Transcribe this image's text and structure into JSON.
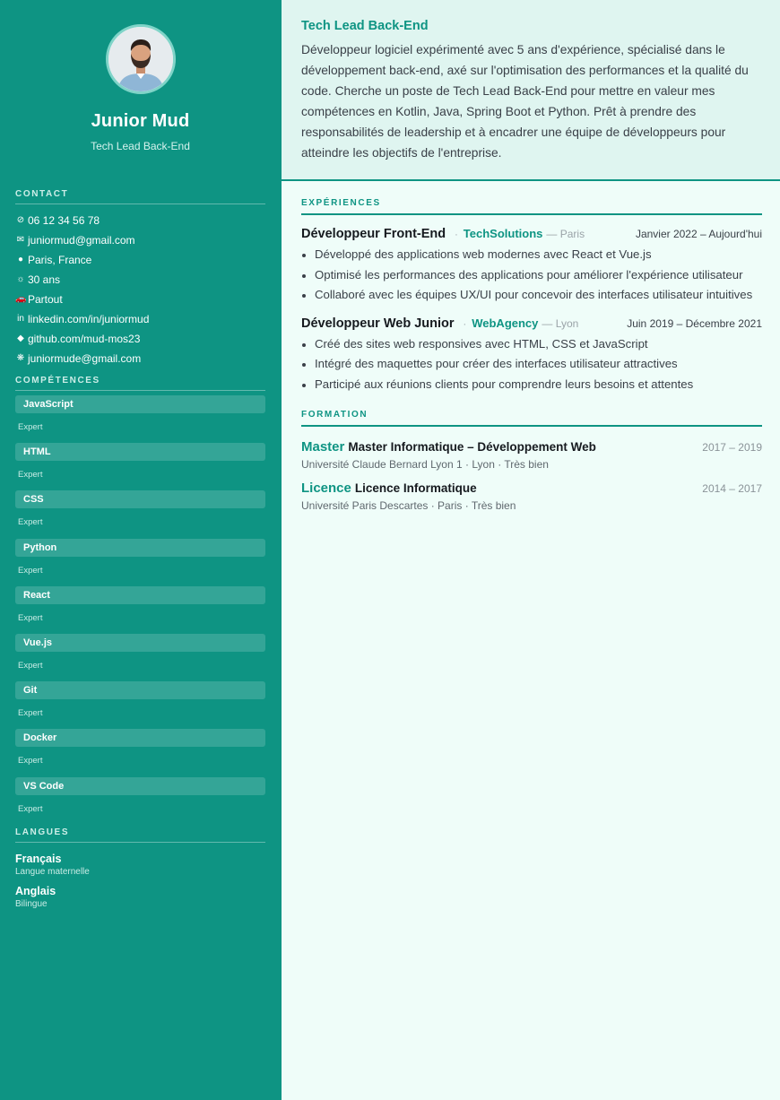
{
  "profile": {
    "name": "Junior Mud",
    "title": "Tech Lead Back-End"
  },
  "contact": {
    "section_title": "CONTACT",
    "items": [
      {
        "icon": "phone-icon",
        "glyph": "⊘",
        "text": "06 12 34 56 78"
      },
      {
        "icon": "email-icon",
        "glyph": "✉",
        "text": "juniormud@gmail.com"
      },
      {
        "icon": "location-icon",
        "glyph": "●",
        "text": "Paris, France"
      },
      {
        "icon": "age-icon",
        "glyph": "☼",
        "text": "30 ans"
      },
      {
        "icon": "car-icon",
        "glyph": "🚗",
        "text": "Partout"
      },
      {
        "icon": "linkedin-icon",
        "glyph": "in",
        "text": "linkedin.com/in/juniormud"
      },
      {
        "icon": "github-icon",
        "glyph": "◆",
        "text": "github.com/mud-mos23"
      },
      {
        "icon": "web-icon",
        "glyph": "❋",
        "text": "juniormude@gmail.com"
      }
    ]
  },
  "skills": {
    "section_title": "COMPÉTENCES",
    "items": [
      {
        "name": "JavaScript",
        "level": "Expert"
      },
      {
        "name": "HTML",
        "level": "Expert"
      },
      {
        "name": "CSS",
        "level": "Expert"
      },
      {
        "name": "Python",
        "level": "Expert"
      },
      {
        "name": "React",
        "level": "Expert"
      },
      {
        "name": "Vue.js",
        "level": "Expert"
      },
      {
        "name": "Git",
        "level": "Expert"
      },
      {
        "name": "Docker",
        "level": "Expert"
      },
      {
        "name": "VS Code",
        "level": "Expert"
      }
    ]
  },
  "languages": {
    "section_title": "LANGUES",
    "items": [
      {
        "name": "Français",
        "level": "Langue maternelle"
      },
      {
        "name": "Anglais",
        "level": "Bilingue"
      }
    ]
  },
  "summary": {
    "title": "Tech Lead Back-End",
    "text": "Développeur logiciel expérimenté avec 5 ans d'expérience, spécialisé dans le développement back-end, axé sur l'optimisation des performances et la qualité du code. Cherche un poste de Tech Lead Back-End pour mettre en valeur mes compétences en Kotlin, Java, Spring Boot et Python. Prêt à prendre des responsabilités de leadership et à encadrer une équipe de développeurs pour atteindre les objectifs de l'entreprise."
  },
  "experience": {
    "section_title": "EXPÉRIENCES",
    "items": [
      {
        "role": "Développeur Front-End",
        "separator": "·",
        "company": "TechSolutions",
        "city": "— Paris",
        "dates": "Janvier 2022 – Aujourd'hui",
        "bullets": [
          "Développé des applications web modernes avec React et Vue.js",
          "Optimisé les performances des applications pour améliorer l'expérience utilisateur",
          "Collaboré avec les équipes UX/UI pour concevoir des interfaces utilisateur intuitives"
        ]
      },
      {
        "role": "Développeur Web Junior",
        "separator": "·",
        "company": "WebAgency",
        "city": "— Lyon",
        "dates": "Juin 2019 – Décembre 2021",
        "bullets": [
          "Créé des sites web responsives avec HTML, CSS et JavaScript",
          "Intégré des maquettes pour créer des interfaces utilisateur attractives",
          "Participé aux réunions clients pour comprendre leurs besoins et attentes"
        ]
      }
    ]
  },
  "education": {
    "section_title": "FORMATION",
    "items": [
      {
        "tag": "Master",
        "degree": "Master Informatique – Développement Web",
        "dates": "2017 – 2019",
        "info": "Université Claude Bernard Lyon 1 · Lyon · Très bien"
      },
      {
        "tag": "Licence",
        "degree": "Licence Informatique",
        "dates": "2014 – 2017",
        "info": "Université Paris Descartes · Paris · Très bien"
      }
    ]
  },
  "colors": {
    "sidebar": "#0e9483",
    "accent": "#0e9483",
    "summary_bg": "#dff5f0",
    "page_bg": "#effdf9"
  }
}
